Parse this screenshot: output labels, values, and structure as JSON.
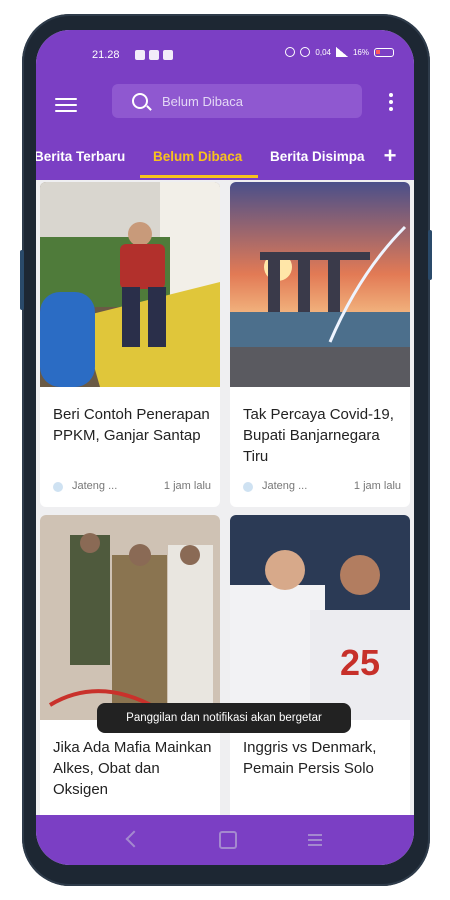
{
  "status_bar": {
    "time": "21.28",
    "network": "0,04",
    "battery": "16%"
  },
  "app_bar": {
    "search_text": "Belum Dibaca"
  },
  "tabs": [
    {
      "label": "Berita Terbaru"
    },
    {
      "label": "Belum Dibaca"
    },
    {
      "label": "Berita Disimpan"
    }
  ],
  "articles": [
    {
      "title": "Beri Contoh Penerapan PPKM, Ganjar Santap",
      "source": "Jateng ...",
      "time": "1 jam lalu"
    },
    {
      "title": "Tak Percaya Covid-19, Bupati Banjarnegara Tiru",
      "source": "Jateng ...",
      "time": "1 jam lalu"
    },
    {
      "title": "Jika Ada Mafia Mainkan Alkes, Obat dan Oksigen",
      "source": "",
      "time": ""
    },
    {
      "title": "Inggris vs Denmark, Pemain Persis Solo",
      "source": "",
      "time": ""
    }
  ],
  "toast": "Panggilan dan notifikasi akan bergetar",
  "colors": {
    "brand_purple": "#7b3fc4",
    "accent_yellow": "#f8c21d"
  }
}
